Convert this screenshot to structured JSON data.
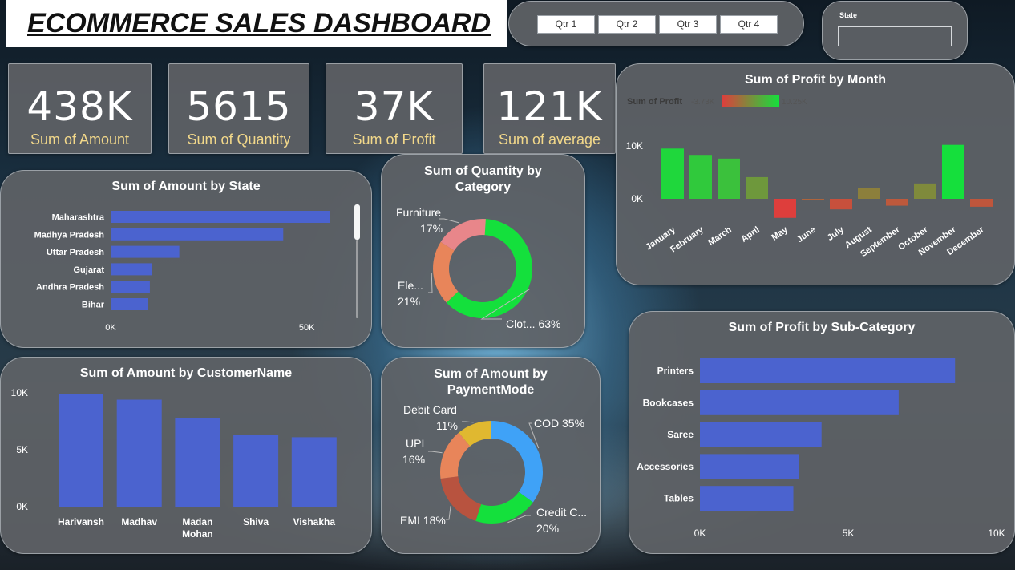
{
  "header": {
    "title": "ECOMMERCE SALES DASHBOARD"
  },
  "quarter_slicer": {
    "buttons": [
      "Qtr 1",
      "Qtr 2",
      "Qtr 3",
      "Qtr 4"
    ]
  },
  "state_slicer": {
    "label": "State",
    "value": ""
  },
  "kpis": [
    {
      "value": "438K",
      "label": "Sum of Amount"
    },
    {
      "value": "5615",
      "label": "Sum of Quantity"
    },
    {
      "value": "37K",
      "label": "Sum of Profit"
    },
    {
      "value": "121K",
      "label": "Sum of average"
    }
  ],
  "colors": {
    "bar_blue": "#4b63cf",
    "green": "#14e03c",
    "red": "#e03c3c",
    "text_gold": "#f2d88a"
  },
  "chart_data": [
    {
      "id": "amount_by_state",
      "type": "bar",
      "orientation": "horizontal",
      "title": "Sum of Amount by State",
      "categories": [
        "Maharashtra",
        "Madhya Pradesh",
        "Uttar Pradesh",
        "Gujarat",
        "Andhra Pradesh",
        "Bihar"
      ],
      "values": [
        56000,
        44000,
        17500,
        10500,
        10000,
        9600
      ],
      "xlim": [
        0,
        56000
      ],
      "ticks": [
        {
          "value": 0,
          "label": "0K"
        },
        {
          "value": 50000,
          "label": "50K"
        }
      ],
      "color": "#4b63cf"
    },
    {
      "id": "quantity_by_category",
      "type": "pie",
      "donut": true,
      "title": "Sum of Quantity by Category",
      "slices": [
        {
          "label": "Clot...",
          "percent": 63,
          "pct_text": "63%",
          "color": "#14e03c"
        },
        {
          "label": "Ele...",
          "percent": 21,
          "pct_text": "21%",
          "color": "#e8855a"
        },
        {
          "label": "Furniture",
          "percent": 17,
          "pct_text": "17%",
          "color": "#e8868a"
        }
      ]
    },
    {
      "id": "profit_by_month",
      "type": "bar",
      "title": "Sum of Profit by Month",
      "legend": {
        "label": "Sum of Profit",
        "min": "-3.73K",
        "max": "10.25K"
      },
      "categories": [
        "January",
        "February",
        "March",
        "April",
        "May",
        "June",
        "July",
        "August",
        "September",
        "October",
        "November",
        "December"
      ],
      "values": [
        9500,
        8300,
        7600,
        4100,
        -3600,
        -300,
        -2000,
        2000,
        -1300,
        2900,
        10200,
        -1500
      ],
      "ylim": [
        -3730,
        10250
      ],
      "ticks": [
        {
          "value": 10000,
          "label": "10K"
        },
        {
          "value": 0,
          "label": "0K"
        }
      ]
    },
    {
      "id": "amount_by_customer",
      "type": "bar",
      "title": "Sum of Amount by CustomerName",
      "categories": [
        "Harivansh",
        "Madhav",
        "Madan Mohan",
        "Shiva",
        "Vishakha"
      ],
      "values": [
        9900,
        9400,
        7800,
        6300,
        6100
      ],
      "ylim": [
        0,
        10000
      ],
      "ticks": [
        {
          "value": 10000,
          "label": "10K"
        },
        {
          "value": 5000,
          "label": "5K"
        },
        {
          "value": 0,
          "label": "0K"
        }
      ],
      "color": "#4b63cf"
    },
    {
      "id": "amount_by_paymentmode",
      "type": "pie",
      "donut": true,
      "title": "Sum of Amount by PaymentMode",
      "slices": [
        {
          "label": "COD",
          "percent": 35,
          "pct_text": "35%",
          "color": "#3fa2f7"
        },
        {
          "label": "Credit C...",
          "percent": 20,
          "pct_text": "20%",
          "color": "#14e03c"
        },
        {
          "label": "EMI",
          "percent": 18,
          "pct_text": "18%",
          "color": "#b8533f"
        },
        {
          "label": "UPI",
          "percent": 16,
          "pct_text": "16%",
          "color": "#e8855a"
        },
        {
          "label": "Debit Card",
          "percent": 11,
          "pct_text": "11%",
          "color": "#e0b830"
        }
      ]
    },
    {
      "id": "profit_by_subcategory",
      "type": "bar",
      "orientation": "horizontal",
      "title": "Sum of Profit by Sub-Category",
      "categories": [
        "Printers",
        "Bookcases",
        "Saree",
        "Accessories",
        "Tables"
      ],
      "values": [
        8600,
        6700,
        4100,
        3350,
        3150
      ],
      "xlim": [
        0,
        10000
      ],
      "ticks": [
        {
          "value": 0,
          "label": "0K"
        },
        {
          "value": 5000,
          "label": "5K"
        },
        {
          "value": 10000,
          "label": "10K"
        }
      ],
      "color": "#4b63cf"
    }
  ]
}
